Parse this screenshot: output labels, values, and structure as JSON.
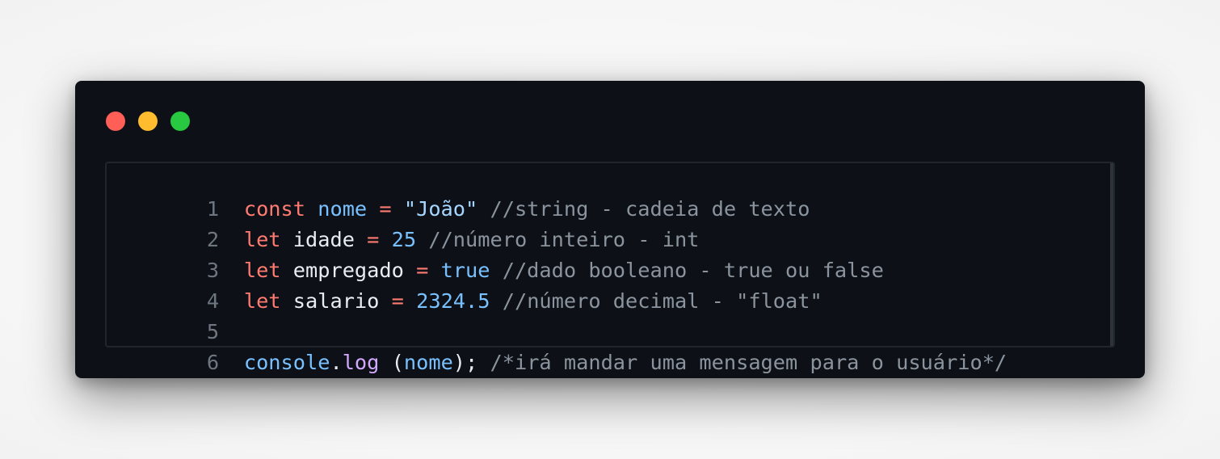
{
  "window": {
    "controls": {
      "close_color": "#ff5f57",
      "minimize_color": "#febc2e",
      "maximize_color": "#28c840"
    }
  },
  "code": {
    "lines": [
      {
        "number": "1",
        "tokens": [
          "const",
          " ",
          "nome",
          " ",
          "=",
          " ",
          "\"João\"",
          " ",
          "//string - cadeia de texto"
        ]
      },
      {
        "number": "2",
        "tokens": [
          "let",
          " ",
          "idade",
          " ",
          "=",
          " ",
          "25",
          " ",
          "//número inteiro - int"
        ]
      },
      {
        "number": "3",
        "tokens": [
          "let",
          " ",
          "empregado",
          " ",
          "=",
          " ",
          "true",
          " ",
          "//dado booleano - true ou false"
        ]
      },
      {
        "number": "4",
        "tokens": [
          "let",
          " ",
          "salario",
          " ",
          "=",
          " ",
          "2324.5",
          " ",
          "//número decimal - \"float\""
        ]
      },
      {
        "number": "5",
        "tokens": []
      },
      {
        "number": "6",
        "tokens": [
          "console",
          ".",
          "log",
          " ",
          "(",
          "nome",
          ");",
          " ",
          "/*irá mandar uma mensagem para o usuário*/"
        ]
      }
    ]
  },
  "theme": {
    "background": "#0d1117",
    "keyword": "#ff7b72",
    "identifier": "#79c0ff",
    "string": "#a5d6ff",
    "comment": "#8b949e",
    "function": "#d2a8ff",
    "text": "#e6edf3",
    "line_number": "#6e7681"
  }
}
